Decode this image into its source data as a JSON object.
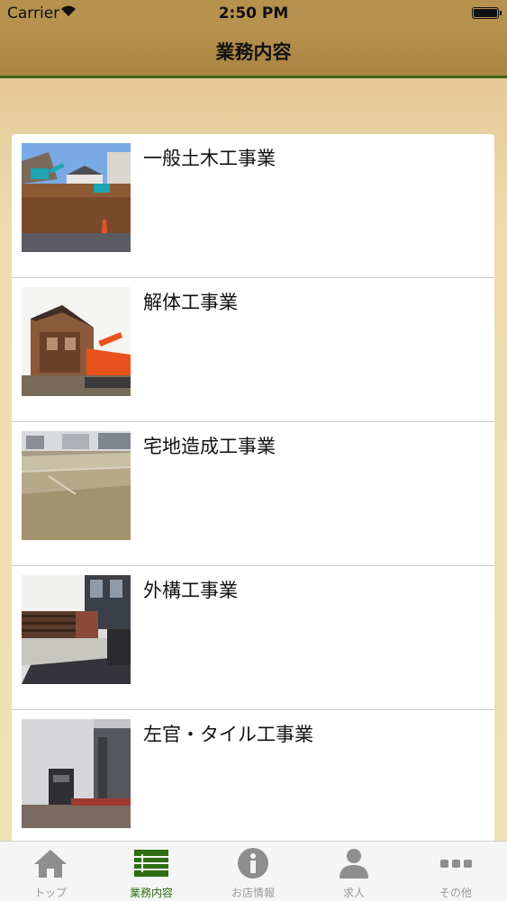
{
  "status_bar": {
    "carrier": "Carrier",
    "time": "2:50 PM"
  },
  "nav": {
    "title": "業務内容"
  },
  "services": [
    {
      "label": "一般土木工事業",
      "image": "excavation-site-photo"
    },
    {
      "label": "解体工事業",
      "image": "house-demolition-photo"
    },
    {
      "label": "宅地造成工事業",
      "image": "land-grading-photo"
    },
    {
      "label": "外構工事業",
      "image": "exterior-construction-photo"
    },
    {
      "label": "左官・タイル工事業",
      "image": "tiled-entrance-photo"
    }
  ],
  "tabs": [
    {
      "label": "トップ",
      "icon": "home-icon"
    },
    {
      "label": "業務内容",
      "icon": "list-icon",
      "active": true
    },
    {
      "label": "お店情報",
      "icon": "info-icon"
    },
    {
      "label": "求人",
      "icon": "person-icon"
    },
    {
      "label": "その他",
      "icon": "more-icon"
    }
  ],
  "colors": {
    "accent": "#2f6f12",
    "header": "#b7924e",
    "background": "#ecd9a6"
  }
}
